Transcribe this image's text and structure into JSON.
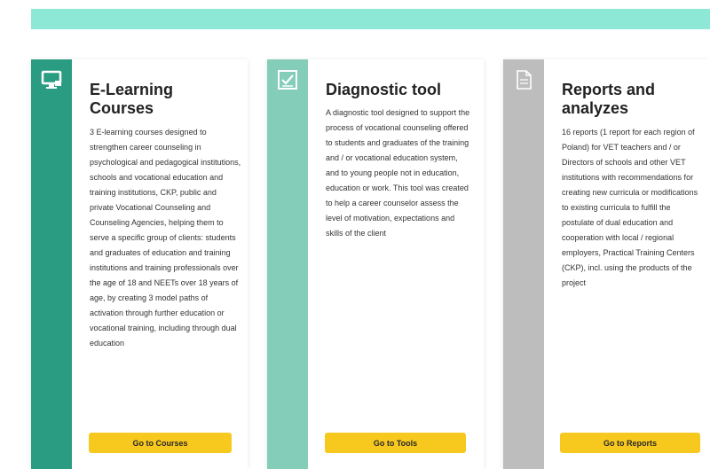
{
  "colors": {
    "banner": "#8ee8d6",
    "strip_courses": "#2a9c82",
    "strip_tools": "#84cdb9",
    "strip_reports": "#bdbdbd",
    "button": "#f7c81d"
  },
  "cards": [
    {
      "icon": "monitor-icon",
      "title": "E-Learning Courses",
      "description": "3 E-learning courses designed to strengthen career counseling in psychological and pedagogical institutions, schools and vocational education and training institutions, CKP, public and private Vocational Counseling and Counseling Agencies, helping them to serve a specific group of clients: students and graduates of education and training institutions and training professionals over the age of 18 and NEETs over 18 years of age, by creating 3 model paths of activation through further education or vocational training, including through dual education",
      "button_label": "Go to Courses"
    },
    {
      "icon": "checklist-icon",
      "title": "Diagnostic tool",
      "description": "A diagnostic tool designed to support the process of vocational counseling offered to students and graduates of the training and / or vocational education system, and to young people not in education, education or work. This tool was created to help a career counselor assess the level of motivation, expectations and skills of the client",
      "button_label": "Go to Tools"
    },
    {
      "icon": "document-icon",
      "title": "Reports and analyzes",
      "description": "16 reports (1 report for each region of Poland) for VET teachers and / or Directors of schools and other VET institutions with recommendations for creating new curricula or modifications to existing curricula to fulfill the postulate of dual education and cooperation with local / regional employers, Practical Training Centers (CKP), incl. using the products of the project",
      "button_label": "Go to Reports"
    }
  ]
}
